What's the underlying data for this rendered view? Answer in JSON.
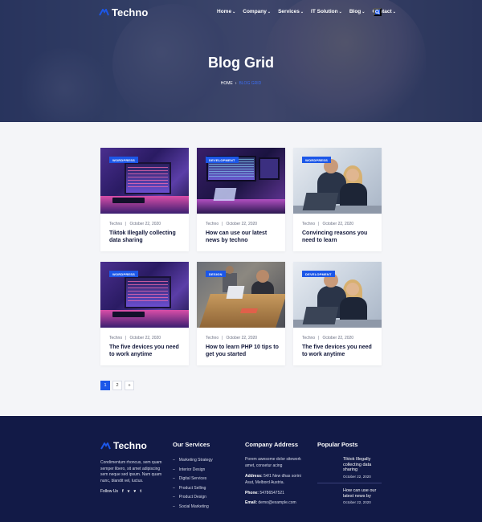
{
  "site": {
    "logo_text": "Techno"
  },
  "nav": {
    "items": [
      {
        "label": "Home",
        "has_dropdown": true
      },
      {
        "label": "Company",
        "has_dropdown": true
      },
      {
        "label": "Services",
        "has_dropdown": true
      },
      {
        "label": "IT Solution",
        "has_dropdown": true
      },
      {
        "label": "Blog",
        "has_dropdown": true
      },
      {
        "label": "Contact",
        "has_dropdown": true
      }
    ],
    "search_icon": "search-icon"
  },
  "hero": {
    "title": "Blog Grid",
    "breadcrumb": {
      "home": "HOME",
      "current": "BLOG GRID"
    }
  },
  "posts": [
    {
      "tag": "WORDPRESS",
      "author": "Techno",
      "date": "October 22, 2020",
      "title": "Tiktok Illegally collecting data sharing",
      "image": "developer-screen"
    },
    {
      "tag": "DEVELOPMENT",
      "author": "Techno",
      "date": "October 22, 2020",
      "title": "How can use our latest news by techno",
      "image": "developer-workspace"
    },
    {
      "tag": "WORDPRESS",
      "author": "Techno",
      "date": "October 22, 2020",
      "title": "Convincing reasons you need to learn",
      "image": "office-meeting"
    },
    {
      "tag": "WORDPRESS",
      "author": "Techno",
      "date": "October 22, 2020",
      "title": "The five devices you need to work anytime",
      "image": "developer-screen"
    },
    {
      "tag": "DESIGN",
      "author": "Techno",
      "date": "October 22, 2020",
      "title": "How to learn PHP 10 tips to get you started",
      "image": "design-team"
    },
    {
      "tag": "DEVELOPMENT",
      "author": "Techno",
      "date": "October 22, 2020",
      "title": "The five devices you need to work anytime",
      "image": "office-meeting"
    }
  ],
  "pagination": {
    "pages": [
      "1",
      "2"
    ],
    "next": "»",
    "current": "1"
  },
  "footer": {
    "logo_text": "Techno",
    "description": "Condimentum rhoncus, sem quam semper libero, sit amet adipiscing sem neque sed ipsum. Nam quam nunc, blandit vel, luctus.",
    "follow_label": "Follow Us",
    "social_icons": [
      "facebook-icon",
      "vimeo-icon",
      "twitter-icon",
      "tumblr-icon"
    ],
    "services": {
      "heading": "Our Services",
      "items": [
        "Marketing Strategy",
        "Interior Design",
        "Digital Services",
        "Product Selling",
        "Product Design",
        "Social Marketing"
      ]
    },
    "address": {
      "heading": "Company Address",
      "intro": "Porem awesome dolor sitework amet, consetur acing",
      "address_label": "Address:",
      "address_value": "54/1 New dhas sorini Asut, Melbord Austria.",
      "phone_label": "Phone:",
      "phone_value": "54786547521",
      "email_label": "Email:",
      "email_value": "demo@example.com"
    },
    "popular": {
      "heading": "Popular Posts",
      "items": [
        {
          "title": "Tiktok Illegally collecting data sharing",
          "date": "October 22, 2020"
        },
        {
          "title": "How can use our latest news by",
          "date": "October 22, 2020"
        }
      ]
    }
  },
  "colors": {
    "accent": "#1c57e8",
    "footer_bg": "#121a47",
    "page_bg": "#f4f5f8"
  }
}
